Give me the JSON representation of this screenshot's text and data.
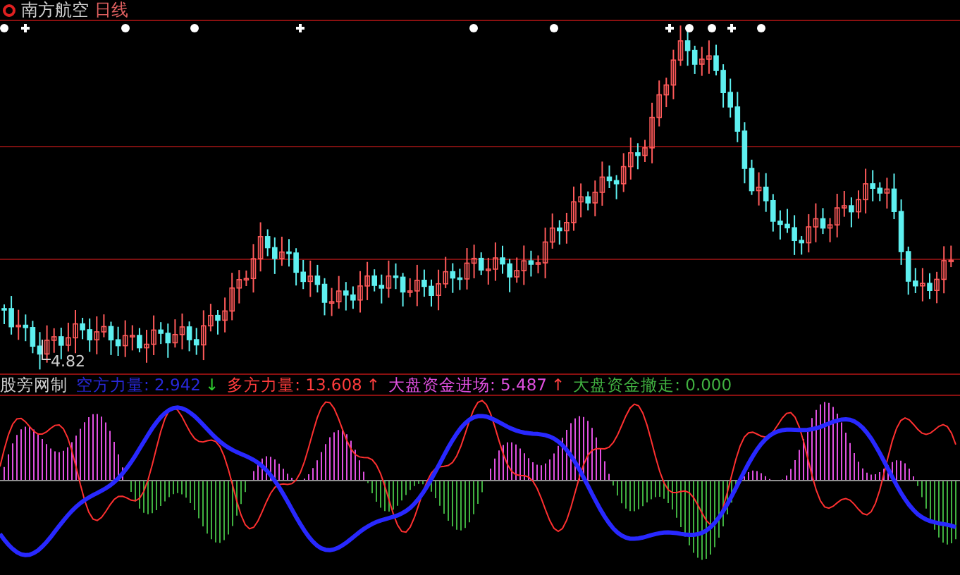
{
  "title": {
    "stock": "南方航空",
    "period": "日线"
  },
  "price_chart": {
    "low_label": "4.82"
  },
  "indicator": {
    "name": "股旁网制",
    "readings": [
      {
        "label": "空方力量:",
        "value": "2.942",
        "arrow": {
          "symbol": "↓",
          "color": "#30d030"
        },
        "color": "#2828d8"
      },
      {
        "label": "多方力量:",
        "value": "13.608",
        "arrow": {
          "symbol": "↑",
          "color": "#ff4040"
        },
        "color": "#ff3c3c"
      },
      {
        "label": "大盘资金进场:",
        "value": "5.487",
        "arrow": {
          "symbol": "↑",
          "color": "#ff4040"
        },
        "color": "#e050e0"
      },
      {
        "label": "大盘资金撤走:",
        "value": "0.000",
        "color": "#40b040"
      }
    ]
  }
}
